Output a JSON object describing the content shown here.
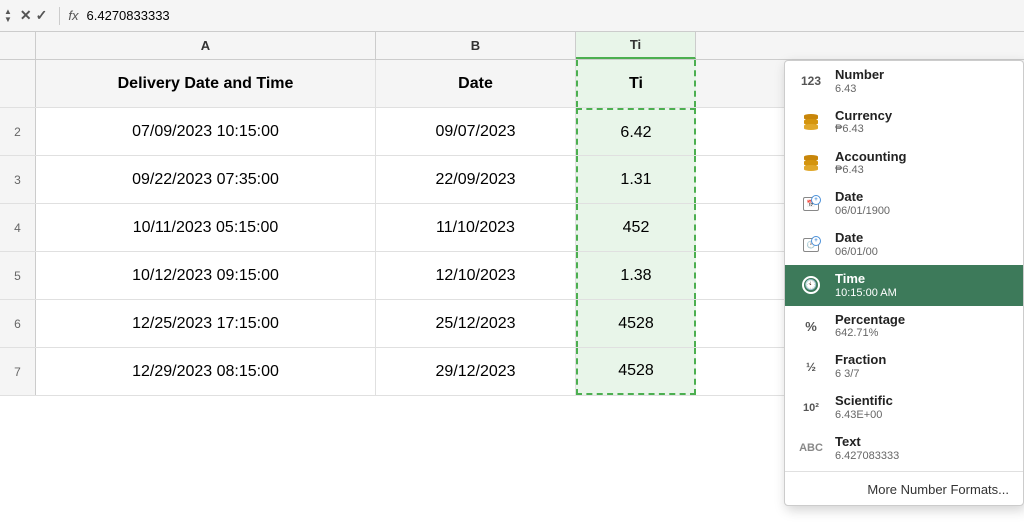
{
  "formula_bar": {
    "formula_value": "6.4270833333",
    "fx_label": "fx"
  },
  "columns": {
    "a_label": "A",
    "b_label": "B",
    "c_label": "Ti"
  },
  "rows": [
    {
      "row_num": "",
      "col_a": "Delivery Date and Time",
      "col_b": "Date",
      "col_c": "Ti",
      "is_header": true
    },
    {
      "row_num": "2",
      "col_a": "07/09/2023 10:15:00",
      "col_b": "09/07/2023",
      "col_c": "6.42",
      "is_header": false
    },
    {
      "row_num": "3",
      "col_a": "09/22/2023 07:35:00",
      "col_b": "22/09/2023",
      "col_c": "1.31",
      "is_header": false
    },
    {
      "row_num": "4",
      "col_a": "10/11/2023 05:15:00",
      "col_b": "11/10/2023",
      "col_c": "452",
      "is_header": false
    },
    {
      "row_num": "5",
      "col_a": "10/12/2023 09:15:00",
      "col_b": "12/10/2023",
      "col_c": "1.38",
      "is_header": false
    },
    {
      "row_num": "6",
      "col_a": "12/25/2023 17:15:00",
      "col_b": "25/12/2023",
      "col_c": "4528",
      "is_header": false
    },
    {
      "row_num": "7",
      "col_a": "12/29/2023 08:15:00",
      "col_b": "29/12/2023",
      "col_c": "4528",
      "is_header": false
    }
  ],
  "format_menu": {
    "items": [
      {
        "id": "number",
        "icon": "123",
        "name": "Number",
        "example": "6.43",
        "selected": false
      },
      {
        "id": "currency",
        "icon": "₱",
        "name": "Currency",
        "example": "₱6.43",
        "selected": false,
        "icon_type": "coin"
      },
      {
        "id": "accounting",
        "icon": "₱",
        "name": "Accounting",
        "example": "₱6.43",
        "selected": false,
        "icon_type": "coin"
      },
      {
        "id": "date1",
        "icon": "cal",
        "name": "Date",
        "example": "06/01/1900",
        "selected": false,
        "icon_type": "calendar-clock"
      },
      {
        "id": "date2",
        "icon": "cal",
        "name": "Date",
        "example": "06/01/00",
        "selected": false,
        "icon_type": "calendar-clock2"
      },
      {
        "id": "time",
        "icon": "🕐",
        "name": "Time",
        "example": "10:15:00 AM",
        "selected": true
      },
      {
        "id": "percentage",
        "icon": "%",
        "name": "Percentage",
        "example": "642.71%",
        "selected": false
      },
      {
        "id": "fraction",
        "icon": "½",
        "name": "Fraction",
        "example": "6 3/7",
        "selected": false
      },
      {
        "id": "scientific",
        "icon": "10²",
        "name": "Scientific",
        "example": "6.43E+00",
        "selected": false
      },
      {
        "id": "text",
        "icon": "ABC",
        "name": "Text",
        "example": "6.427083333",
        "selected": false
      }
    ],
    "more_label": "More Number Formats..."
  }
}
